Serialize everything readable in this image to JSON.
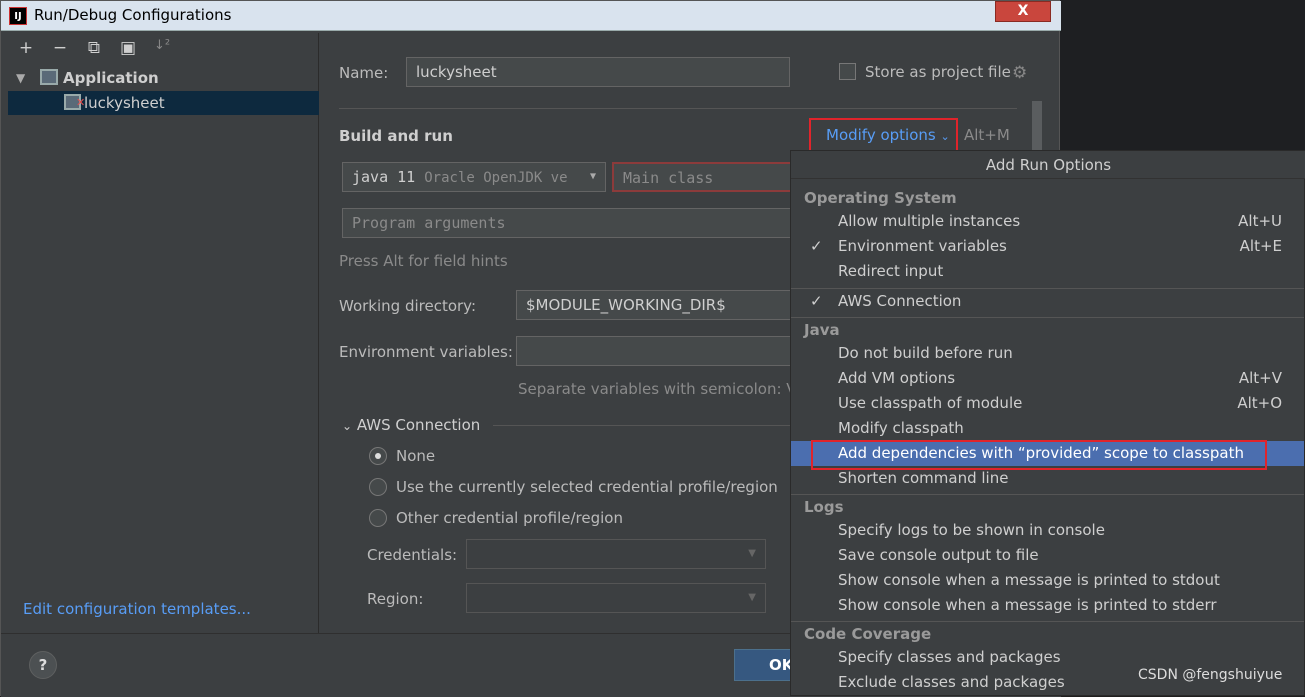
{
  "window": {
    "title": "Run/Debug Configurations",
    "close_label": "X",
    "app_icon_label": "IJ"
  },
  "toolbar": {
    "add": "+",
    "remove": "−",
    "copy": "⧉",
    "folder": "▣",
    "sort": "↓²"
  },
  "tree": {
    "group_label": "Application",
    "item_label": "luckysheet"
  },
  "left": {
    "edit_templates": "Edit configuration templates..."
  },
  "form": {
    "name_label": "Name:",
    "name_value": "luckysheet",
    "store_label": "Store as project file",
    "build_run_title": "Build and run",
    "modify_options": "Modify options",
    "modify_shortcut": "Alt+M",
    "jdk_value": "java 11",
    "jdk_detail": "Oracle OpenJDK ve",
    "main_class_placeholder": "Main class",
    "program_args_placeholder": "Program arguments",
    "field_hint": "Press Alt for field hints",
    "working_dir_label": "Working directory:",
    "working_dir_value": "$MODULE_WORKING_DIR$",
    "env_vars_label": "Environment variables:",
    "env_hint": "Separate variables with semicolon: VA",
    "aws_section": "AWS Connection",
    "radio_none": "None",
    "radio_current": "Use the currently selected credential profile/region",
    "radio_other": "Other credential profile/region",
    "credentials_label": "Credentials:",
    "region_label": "Region:"
  },
  "buttons": {
    "help": "?",
    "ok": "OK"
  },
  "popup": {
    "title": "Add Run Options",
    "sections": {
      "os": "Operating System",
      "java": "Java",
      "logs": "Logs",
      "coverage": "Code Coverage"
    },
    "items": {
      "multi": {
        "label": "Allow multiple instances",
        "shortcut": "Alt+U"
      },
      "env": {
        "label": "Environment variables",
        "shortcut": "Alt+E",
        "check": "✓"
      },
      "redirect": {
        "label": "Redirect input"
      },
      "aws": {
        "label": "AWS Connection",
        "check": "✓"
      },
      "nobuild": {
        "label": "Do not build before run"
      },
      "vm": {
        "label": "Add VM options",
        "shortcut": "Alt+V"
      },
      "cp_module": {
        "label": "Use classpath of module",
        "shortcut": "Alt+O"
      },
      "modify_cp": {
        "label": "Modify classpath"
      },
      "provided": {
        "label": "Add dependencies with “provided” scope to classpath"
      },
      "shorten": {
        "label": "Shorten command line"
      },
      "logs_console": {
        "label": "Specify logs to be shown in console"
      },
      "save_console": {
        "label": "Save console output to file"
      },
      "stdout": {
        "label": "Show console when a message is printed to stdout"
      },
      "stderr": {
        "label": "Show console when a message is printed to stderr"
      },
      "cov_specify": {
        "label": "Specify classes and packages"
      },
      "cov_exclude": {
        "label": "Exclude classes and packages"
      }
    }
  },
  "watermark": "CSDN @fengshuiyue",
  "colors": {
    "accent": "#4b6eaf",
    "link": "#589df6",
    "highlight_box": "#e0242b"
  }
}
